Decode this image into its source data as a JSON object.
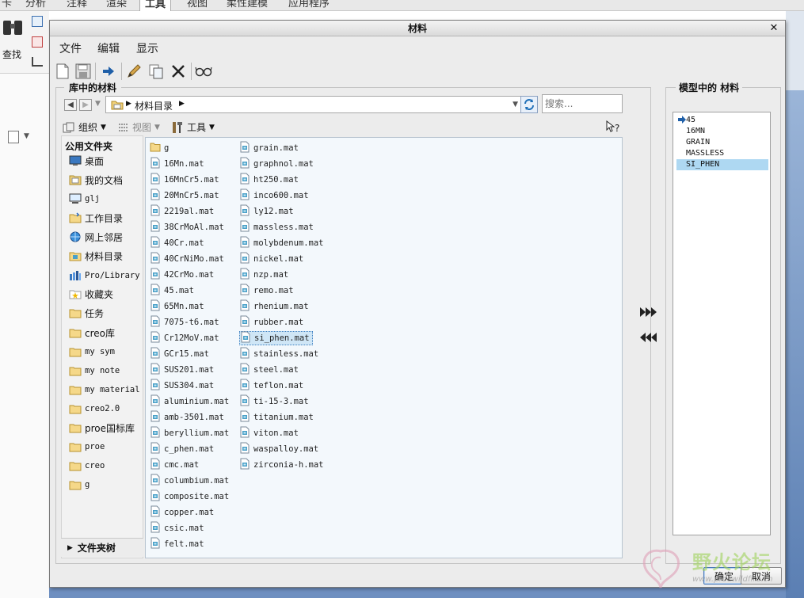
{
  "app": {
    "ribbon_tabs": [
      "卡",
      "分析",
      "注释",
      "渲染",
      "工具",
      "视图",
      "柔性建模",
      "应用程序"
    ],
    "active_tab": "工具",
    "find_label": "查找"
  },
  "dialog": {
    "title": "材料",
    "menu": [
      "文件",
      "编辑",
      "显示"
    ],
    "toolbar_icons": [
      "new-file-icon",
      "save-icon",
      "arrow-right-icon",
      "pencil-icon",
      "copy-icon",
      "delete-icon",
      "glasses-icon"
    ],
    "library": {
      "title": "库中的材料",
      "path_segment": "材料目录",
      "search_placeholder": "搜索...",
      "org_label": "组织",
      "view_label": "视图",
      "tools_label": "工具",
      "sidebar_header": "公用文件夹",
      "favorites": [
        {
          "label": "桌面",
          "icon": "desktop-icon"
        },
        {
          "label": "我的文档",
          "icon": "documents-icon"
        },
        {
          "label": "glj",
          "icon": "computer-icon"
        },
        {
          "label": "工作目录",
          "icon": "work-folder-icon"
        },
        {
          "label": "网上邻居",
          "icon": "network-icon"
        },
        {
          "label": "材料目录",
          "icon": "materials-folder-icon"
        },
        {
          "label": "Pro/Library",
          "icon": "library-icon"
        },
        {
          "label": "收藏夹",
          "icon": "favorites-icon"
        },
        {
          "label": "任务",
          "icon": "folder-icon"
        },
        {
          "label": "creo库",
          "icon": "folder-icon"
        },
        {
          "label": "my sym",
          "icon": "folder-icon"
        },
        {
          "label": "my note",
          "icon": "folder-icon"
        },
        {
          "label": "my material",
          "icon": "folder-icon"
        },
        {
          "label": "creo2.0",
          "icon": "folder-icon"
        },
        {
          "label": "proe国标库",
          "icon": "folder-icon"
        },
        {
          "label": "proe",
          "icon": "folder-icon"
        },
        {
          "label": "creo",
          "icon": "folder-icon"
        },
        {
          "label": "g",
          "icon": "folder-icon"
        }
      ],
      "folder_tree_label": "文件夹树",
      "files_col1": [
        "g",
        "16Mn.mat",
        "16MnCr5.mat",
        "20MnCr5.mat",
        "2219al.mat",
        "38CrMoAl.mat",
        "40Cr.mat",
        "40CrNiMo.mat",
        "42CrMo.mat",
        "45.mat",
        "65Mn.mat",
        "7075-t6.mat",
        "Cr12MoV.mat",
        "GCr15.mat",
        "SUS201.mat",
        "SUS304.mat",
        "aluminium.mat",
        "amb-3501.mat",
        "beryllium.mat",
        "c_phen.mat",
        "cmc.mat",
        "columbium.mat",
        "composite.mat",
        "copper.mat",
        "csic.mat",
        "felt.mat"
      ],
      "files_col2": [
        "grain.mat",
        "graphnol.mat",
        "ht250.mat",
        "inco600.mat",
        "ly12.mat",
        "massless.mat",
        "molybdenum.mat",
        "nickel.mat",
        "nzp.mat",
        "remo.mat",
        "rhenium.mat",
        "rubber.mat",
        "si_phen.mat",
        "stainless.mat",
        "steel.mat",
        "teflon.mat",
        "ti-15-3.mat",
        "titanium.mat",
        "viton.mat",
        "waspalloy.mat",
        "zirconia-h.mat"
      ],
      "selected_file": "si_phen.mat"
    },
    "model": {
      "title": "模型中的 材料",
      "items": [
        "45",
        "16MN",
        "GRAIN",
        "MASSLESS",
        "SI_PHEN"
      ],
      "selected": "SI_PHEN"
    },
    "buttons": {
      "ok": "确定",
      "cancel": "取消"
    }
  },
  "watermark": {
    "text": "野火论坛",
    "url": "www.proewildfire.cn"
  },
  "colors": {
    "accent": "#3d7fc0",
    "selection": "#cfe6f6",
    "model_selection": "#aed8f2"
  }
}
